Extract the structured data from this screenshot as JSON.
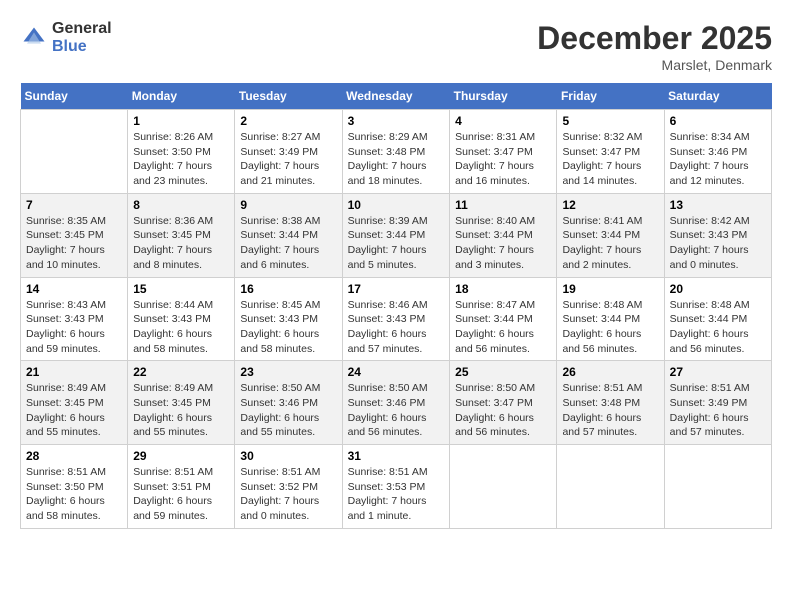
{
  "logo": {
    "text_general": "General",
    "text_blue": "Blue"
  },
  "title": "December 2025",
  "subtitle": "Marslet, Denmark",
  "days_header": [
    "Sunday",
    "Monday",
    "Tuesday",
    "Wednesday",
    "Thursday",
    "Friday",
    "Saturday"
  ],
  "weeks": [
    [
      {
        "day": "",
        "sunrise": "",
        "sunset": "",
        "daylight": ""
      },
      {
        "day": "1",
        "sunrise": "Sunrise: 8:26 AM",
        "sunset": "Sunset: 3:50 PM",
        "daylight": "Daylight: 7 hours and 23 minutes."
      },
      {
        "day": "2",
        "sunrise": "Sunrise: 8:27 AM",
        "sunset": "Sunset: 3:49 PM",
        "daylight": "Daylight: 7 hours and 21 minutes."
      },
      {
        "day": "3",
        "sunrise": "Sunrise: 8:29 AM",
        "sunset": "Sunset: 3:48 PM",
        "daylight": "Daylight: 7 hours and 18 minutes."
      },
      {
        "day": "4",
        "sunrise": "Sunrise: 8:31 AM",
        "sunset": "Sunset: 3:47 PM",
        "daylight": "Daylight: 7 hours and 16 minutes."
      },
      {
        "day": "5",
        "sunrise": "Sunrise: 8:32 AM",
        "sunset": "Sunset: 3:47 PM",
        "daylight": "Daylight: 7 hours and 14 minutes."
      },
      {
        "day": "6",
        "sunrise": "Sunrise: 8:34 AM",
        "sunset": "Sunset: 3:46 PM",
        "daylight": "Daylight: 7 hours and 12 minutes."
      }
    ],
    [
      {
        "day": "7",
        "sunrise": "Sunrise: 8:35 AM",
        "sunset": "Sunset: 3:45 PM",
        "daylight": "Daylight: 7 hours and 10 minutes."
      },
      {
        "day": "8",
        "sunrise": "Sunrise: 8:36 AM",
        "sunset": "Sunset: 3:45 PM",
        "daylight": "Daylight: 7 hours and 8 minutes."
      },
      {
        "day": "9",
        "sunrise": "Sunrise: 8:38 AM",
        "sunset": "Sunset: 3:44 PM",
        "daylight": "Daylight: 7 hours and 6 minutes."
      },
      {
        "day": "10",
        "sunrise": "Sunrise: 8:39 AM",
        "sunset": "Sunset: 3:44 PM",
        "daylight": "Daylight: 7 hours and 5 minutes."
      },
      {
        "day": "11",
        "sunrise": "Sunrise: 8:40 AM",
        "sunset": "Sunset: 3:44 PM",
        "daylight": "Daylight: 7 hours and 3 minutes."
      },
      {
        "day": "12",
        "sunrise": "Sunrise: 8:41 AM",
        "sunset": "Sunset: 3:44 PM",
        "daylight": "Daylight: 7 hours and 2 minutes."
      },
      {
        "day": "13",
        "sunrise": "Sunrise: 8:42 AM",
        "sunset": "Sunset: 3:43 PM",
        "daylight": "Daylight: 7 hours and 0 minutes."
      }
    ],
    [
      {
        "day": "14",
        "sunrise": "Sunrise: 8:43 AM",
        "sunset": "Sunset: 3:43 PM",
        "daylight": "Daylight: 6 hours and 59 minutes."
      },
      {
        "day": "15",
        "sunrise": "Sunrise: 8:44 AM",
        "sunset": "Sunset: 3:43 PM",
        "daylight": "Daylight: 6 hours and 58 minutes."
      },
      {
        "day": "16",
        "sunrise": "Sunrise: 8:45 AM",
        "sunset": "Sunset: 3:43 PM",
        "daylight": "Daylight: 6 hours and 58 minutes."
      },
      {
        "day": "17",
        "sunrise": "Sunrise: 8:46 AM",
        "sunset": "Sunset: 3:43 PM",
        "daylight": "Daylight: 6 hours and 57 minutes."
      },
      {
        "day": "18",
        "sunrise": "Sunrise: 8:47 AM",
        "sunset": "Sunset: 3:44 PM",
        "daylight": "Daylight: 6 hours and 56 minutes."
      },
      {
        "day": "19",
        "sunrise": "Sunrise: 8:48 AM",
        "sunset": "Sunset: 3:44 PM",
        "daylight": "Daylight: 6 hours and 56 minutes."
      },
      {
        "day": "20",
        "sunrise": "Sunrise: 8:48 AM",
        "sunset": "Sunset: 3:44 PM",
        "daylight": "Daylight: 6 hours and 56 minutes."
      }
    ],
    [
      {
        "day": "21",
        "sunrise": "Sunrise: 8:49 AM",
        "sunset": "Sunset: 3:45 PM",
        "daylight": "Daylight: 6 hours and 55 minutes."
      },
      {
        "day": "22",
        "sunrise": "Sunrise: 8:49 AM",
        "sunset": "Sunset: 3:45 PM",
        "daylight": "Daylight: 6 hours and 55 minutes."
      },
      {
        "day": "23",
        "sunrise": "Sunrise: 8:50 AM",
        "sunset": "Sunset: 3:46 PM",
        "daylight": "Daylight: 6 hours and 55 minutes."
      },
      {
        "day": "24",
        "sunrise": "Sunrise: 8:50 AM",
        "sunset": "Sunset: 3:46 PM",
        "daylight": "Daylight: 6 hours and 56 minutes."
      },
      {
        "day": "25",
        "sunrise": "Sunrise: 8:50 AM",
        "sunset": "Sunset: 3:47 PM",
        "daylight": "Daylight: 6 hours and 56 minutes."
      },
      {
        "day": "26",
        "sunrise": "Sunrise: 8:51 AM",
        "sunset": "Sunset: 3:48 PM",
        "daylight": "Daylight: 6 hours and 57 minutes."
      },
      {
        "day": "27",
        "sunrise": "Sunrise: 8:51 AM",
        "sunset": "Sunset: 3:49 PM",
        "daylight": "Daylight: 6 hours and 57 minutes."
      }
    ],
    [
      {
        "day": "28",
        "sunrise": "Sunrise: 8:51 AM",
        "sunset": "Sunset: 3:50 PM",
        "daylight": "Daylight: 6 hours and 58 minutes."
      },
      {
        "day": "29",
        "sunrise": "Sunrise: 8:51 AM",
        "sunset": "Sunset: 3:51 PM",
        "daylight": "Daylight: 6 hours and 59 minutes."
      },
      {
        "day": "30",
        "sunrise": "Sunrise: 8:51 AM",
        "sunset": "Sunset: 3:52 PM",
        "daylight": "Daylight: 7 hours and 0 minutes."
      },
      {
        "day": "31",
        "sunrise": "Sunrise: 8:51 AM",
        "sunset": "Sunset: 3:53 PM",
        "daylight": "Daylight: 7 hours and 1 minute."
      },
      {
        "day": "",
        "sunrise": "",
        "sunset": "",
        "daylight": ""
      },
      {
        "day": "",
        "sunrise": "",
        "sunset": "",
        "daylight": ""
      },
      {
        "day": "",
        "sunrise": "",
        "sunset": "",
        "daylight": ""
      }
    ]
  ]
}
